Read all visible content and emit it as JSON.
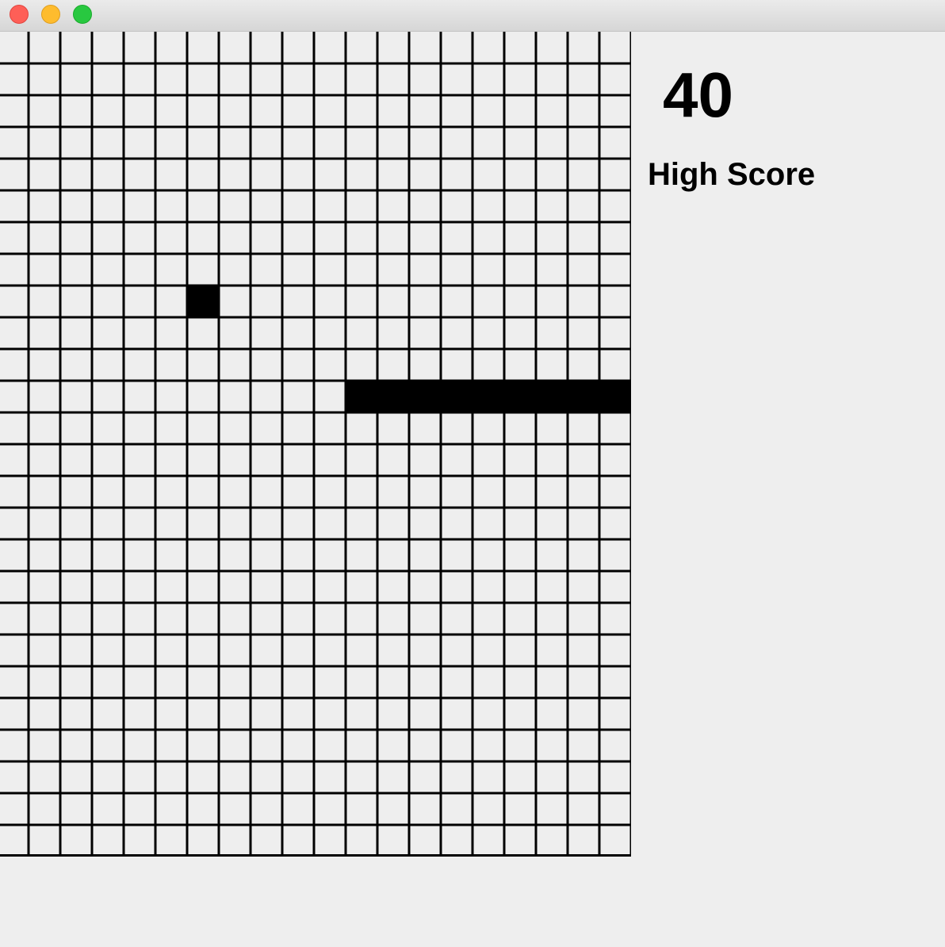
{
  "window": {
    "controls": {
      "close_icon": "close-icon",
      "minimize_icon": "minimize-icon",
      "zoom_icon": "zoom-icon",
      "colors": {
        "close": "#fe5f57",
        "minimize": "#febc2e",
        "zoom": "#28c840"
      }
    }
  },
  "game": {
    "grid": {
      "columns": 20,
      "rows": 26,
      "line_color": "#000000",
      "cell_color": "#eeeeee"
    },
    "food": {
      "col": 6,
      "row": 8
    },
    "snake": {
      "segments": [
        {
          "col": 11,
          "row": 11
        },
        {
          "col": 12,
          "row": 11
        },
        {
          "col": 13,
          "row": 11
        },
        {
          "col": 14,
          "row": 11
        },
        {
          "col": 15,
          "row": 11
        },
        {
          "col": 16,
          "row": 11
        },
        {
          "col": 17,
          "row": 11
        },
        {
          "col": 18,
          "row": 11
        },
        {
          "col": 19,
          "row": 11
        }
      ],
      "color": "#000000"
    }
  },
  "scoreboard": {
    "score": "40",
    "label": "High Score"
  }
}
